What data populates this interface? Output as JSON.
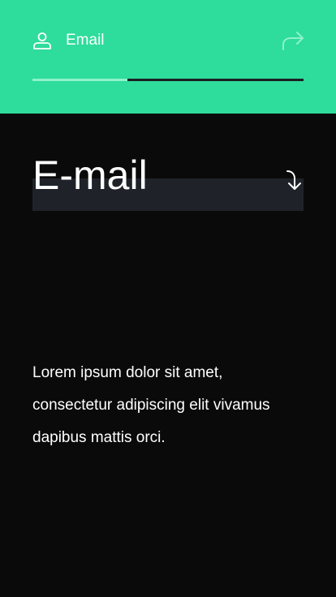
{
  "header": {
    "step_label": "Email",
    "progress": 0.35,
    "icons": {
      "user": "user-outline-icon",
      "next": "forward-arrow-icon"
    }
  },
  "form": {
    "field_placeholder": "E-mail",
    "field_value": "",
    "submit_icon": "enter-arrow-icon"
  },
  "body": {
    "description": "Lorem ipsum dolor sit amet, consectetur adipiscing elit vivamus dapibus mattis orci."
  },
  "colors": {
    "accent": "#2edc9b",
    "progress_fill": "#8ef3c9",
    "background": "#0a0a0a",
    "field_background": "#1f2329"
  }
}
